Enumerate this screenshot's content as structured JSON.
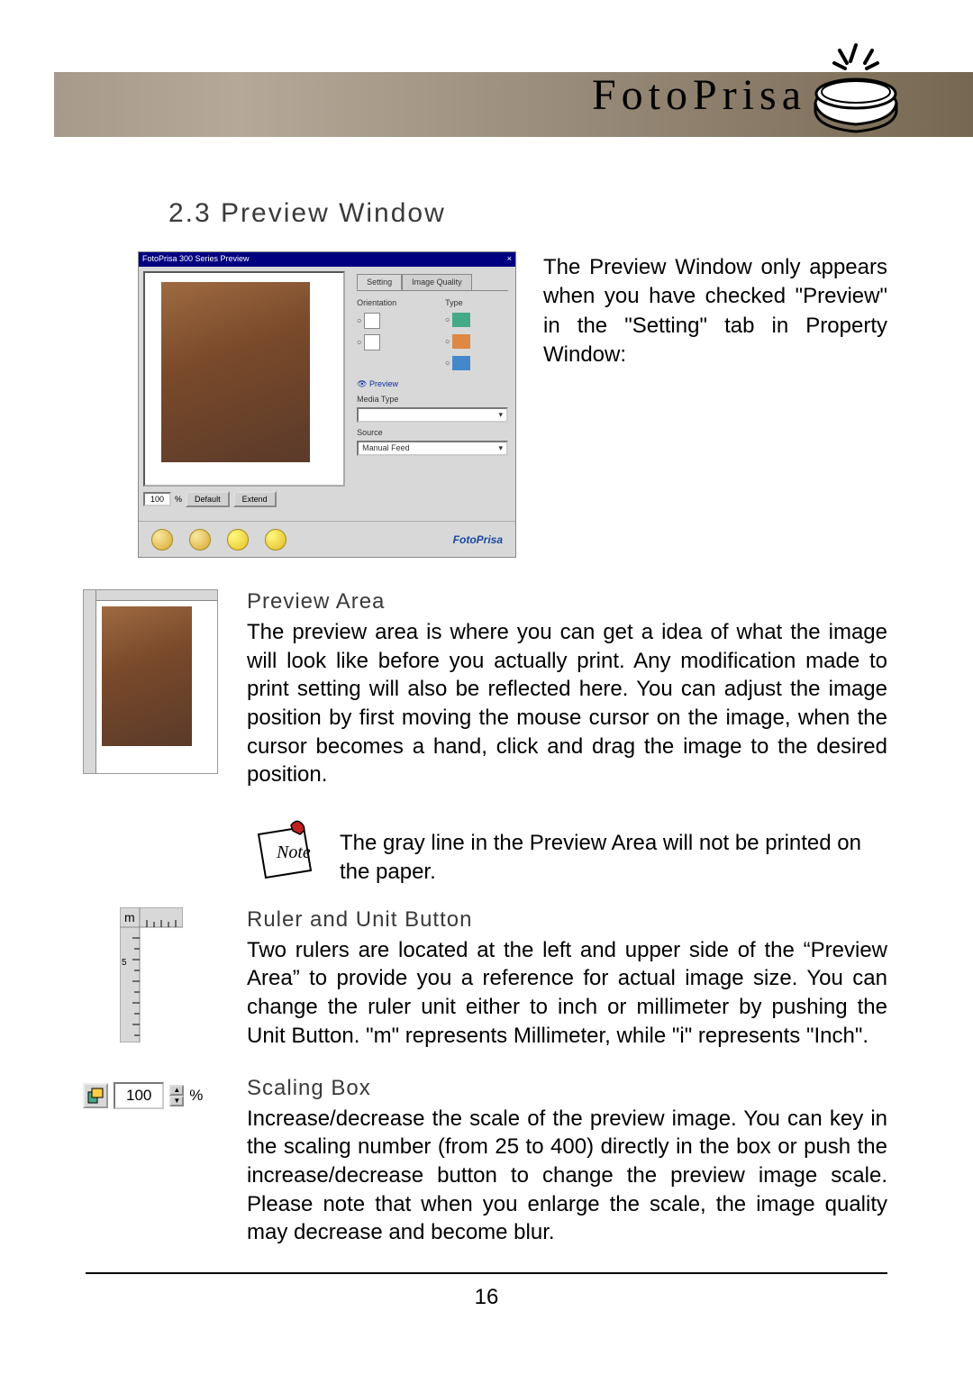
{
  "header": {
    "brand": "FotoPrisa"
  },
  "section": {
    "heading": "2.3 Preview Window",
    "intro": "The Preview Window only appears when you have checked \"Preview\" in the \"Setting\" tab in Property Window:"
  },
  "preview_window": {
    "titlebar": "FotoPrisa 300 Series Preview",
    "tabs": {
      "setting": "Setting",
      "image_quality": "Image Quality"
    },
    "labels": {
      "orientation": "Orientation",
      "type": "Type",
      "preview_check": "Preview",
      "media_type": "Media Type",
      "source": "Source",
      "manual_feed": "Manual Feed"
    },
    "scale_value": "100",
    "buttons": {
      "default": "Default",
      "extend": "Extend"
    },
    "logo": "FotoPrisa"
  },
  "subsections": {
    "preview_area": {
      "heading": "Preview Area",
      "text": "The preview area is where you can get a idea of what the image will look like before you actually print. Any modification made to print setting will also be reflected here. You can adjust the image position by first moving the mouse cursor on the image, when the cursor becomes a hand, click and drag the image to the desired position."
    },
    "note": {
      "text": "The gray line in the  Preview Area  will not be printed on the paper."
    },
    "ruler": {
      "heading": "Ruler and Unit Button",
      "text": "Two rulers are located at the left and upper side of the “Preview Area” to provide you a reference for actual image size. You can change the ruler unit either to inch or millimeter by pushing the Unit Button. \"m\" represents Millimeter, while \"i\" represents \"Inch\".",
      "unit_label": "m"
    },
    "scaling": {
      "heading": "Scaling Box",
      "text": "Increase/decrease the scale of the preview image. You can key in the scaling number (from 25 to 400) directly in the box or push the increase/decrease button to change the preview image scale. Please note that when you enlarge the scale, the image quality may decrease and become blur.",
      "value": "100",
      "percent": "%"
    }
  },
  "page_number": "16"
}
